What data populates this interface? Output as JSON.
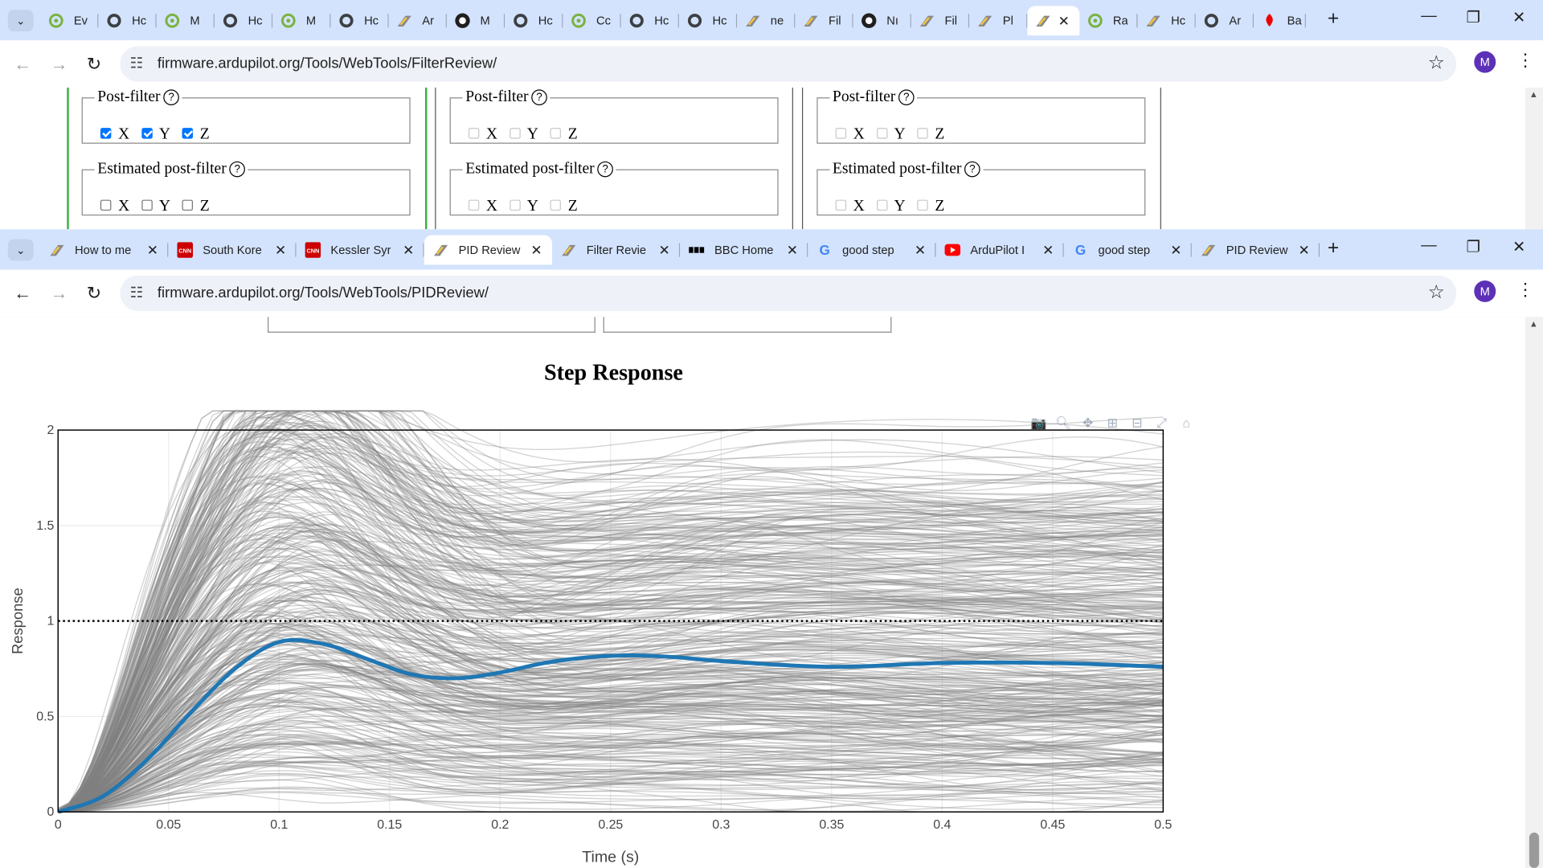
{
  "window1": {
    "tabs": [
      {
        "label": "Ev",
        "icon": "circle-favicon"
      },
      {
        "label": "Hc",
        "icon": "globe-favicon"
      },
      {
        "label": "M",
        "icon": "circle-favicon"
      },
      {
        "label": "Hc",
        "icon": "globe-favicon"
      },
      {
        "label": "M",
        "icon": "circle-favicon"
      },
      {
        "label": "Hc",
        "icon": "globe-favicon"
      },
      {
        "label": "Ar",
        "icon": "ardupilot-favicon"
      },
      {
        "label": "M",
        "icon": "github-favicon"
      },
      {
        "label": "Hc",
        "icon": "globe-favicon"
      },
      {
        "label": "Cc",
        "icon": "circle-favicon"
      },
      {
        "label": "Hc",
        "icon": "globe-favicon"
      },
      {
        "label": "Hc",
        "icon": "globe-favicon"
      },
      {
        "label": "ne",
        "icon": "ardupilot-favicon"
      },
      {
        "label": "Fil",
        "icon": "ardupilot-favicon"
      },
      {
        "label": "Nı",
        "icon": "github-favicon"
      },
      {
        "label": "Fil",
        "icon": "ardupilot-favicon"
      },
      {
        "label": "Pl",
        "icon": "ardupilot-favicon"
      },
      {
        "label": "",
        "icon": "ardupilot-favicon",
        "active": true
      },
      {
        "label": "Ra",
        "icon": "circle-favicon"
      },
      {
        "label": "Hc",
        "icon": "ardupilot-favicon"
      },
      {
        "label": "Ar",
        "icon": "globe-favicon"
      },
      {
        "label": "Ba",
        "icon": "santander-favicon"
      }
    ],
    "url": "firmware.ardupilot.org/Tools/WebTools/FilterReview/",
    "avatar": "M"
  },
  "filter_panels": [
    {
      "postfilter_title": "Post-filter",
      "estimated_title": "Estimated post-filter",
      "help": "?",
      "post": [
        {
          "axis": "X",
          "checked": true,
          "enabled": true
        },
        {
          "axis": "Y",
          "checked": true,
          "enabled": true
        },
        {
          "axis": "Z",
          "checked": true,
          "enabled": true
        }
      ],
      "est": [
        {
          "axis": "X",
          "checked": false,
          "enabled": true
        },
        {
          "axis": "Y",
          "checked": false,
          "enabled": true
        },
        {
          "axis": "Z",
          "checked": false,
          "enabled": true
        }
      ]
    },
    {
      "postfilter_title": "Post-filter",
      "estimated_title": "Estimated post-filter",
      "help": "?",
      "post": [
        {
          "axis": "X",
          "checked": false,
          "enabled": false
        },
        {
          "axis": "Y",
          "checked": false,
          "enabled": false
        },
        {
          "axis": "Z",
          "checked": false,
          "enabled": false
        }
      ],
      "est": [
        {
          "axis": "X",
          "checked": false,
          "enabled": false
        },
        {
          "axis": "Y",
          "checked": false,
          "enabled": false
        },
        {
          "axis": "Z",
          "checked": false,
          "enabled": false
        }
      ]
    },
    {
      "postfilter_title": "Post-filter",
      "estimated_title": "Estimated post-filter",
      "help": "?",
      "post": [
        {
          "axis": "X",
          "checked": false,
          "enabled": false
        },
        {
          "axis": "Y",
          "checked": false,
          "enabled": false
        },
        {
          "axis": "Z",
          "checked": false,
          "enabled": false
        }
      ],
      "est": [
        {
          "axis": "X",
          "checked": false,
          "enabled": false
        },
        {
          "axis": "Y",
          "checked": false,
          "enabled": false
        },
        {
          "axis": "Z",
          "checked": false,
          "enabled": false
        }
      ]
    }
  ],
  "window2": {
    "tabs": [
      {
        "label": "How to me",
        "icon": "ardupilot-favicon"
      },
      {
        "label": "South Kore",
        "icon": "cnn-favicon"
      },
      {
        "label": "Kessler Syr",
        "icon": "cnn-favicon"
      },
      {
        "label": "PID Review",
        "icon": "ardupilot-favicon",
        "active": true
      },
      {
        "label": "Filter Revie",
        "icon": "ardupilot-favicon"
      },
      {
        "label": "BBC Home",
        "icon": "bbc-favicon"
      },
      {
        "label": "good step",
        "icon": "google-favicon"
      },
      {
        "label": "ArduPilot I",
        "icon": "youtube-favicon"
      },
      {
        "label": "good step",
        "icon": "google-favicon"
      },
      {
        "label": "PID Review",
        "icon": "ardupilot-favicon"
      }
    ],
    "url": "firmware.ardupilot.org/Tools/WebTools/PIDReview/",
    "avatar": "M"
  },
  "chart_data": {
    "type": "line",
    "title": "Step Response",
    "xlabel": "Time (s)",
    "ylabel": "Response",
    "xlim": [
      0,
      0.5
    ],
    "ylim": [
      0,
      2
    ],
    "xticks": [
      "0",
      "0.05",
      "0.1",
      "0.15",
      "0.2",
      "0.25",
      "0.3",
      "0.35",
      "0.4",
      "0.45",
      "0.5"
    ],
    "yticks": [
      "0",
      "0.5",
      "1",
      "1.5",
      "2"
    ],
    "grid": true,
    "legend": "none",
    "reference": {
      "y": 1,
      "style": "dotted",
      "color": "#000000"
    },
    "individual_responses": {
      "count": 400,
      "color": "#808080",
      "opacity": 0.35,
      "peak_range": [
        0.1,
        2.0
      ]
    },
    "series": [
      {
        "color": "#1f77b4",
        "x": [
          0,
          0.02,
          0.04,
          0.06,
          0.08,
          0.1,
          0.12,
          0.14,
          0.16,
          0.18,
          0.2,
          0.22,
          0.24,
          0.26,
          0.28,
          0.3,
          0.35,
          0.4,
          0.45,
          0.5
        ],
        "y": [
          0,
          0.08,
          0.27,
          0.52,
          0.75,
          0.89,
          0.88,
          0.8,
          0.72,
          0.7,
          0.73,
          0.78,
          0.81,
          0.82,
          0.81,
          0.79,
          0.76,
          0.78,
          0.78,
          0.76
        ]
      }
    ],
    "modebar": [
      "camera-icon",
      "zoom-icon",
      "pan-icon",
      "zoom-in-icon",
      "zoom-out-icon",
      "autoscale-icon",
      "reset-axes-icon"
    ]
  }
}
